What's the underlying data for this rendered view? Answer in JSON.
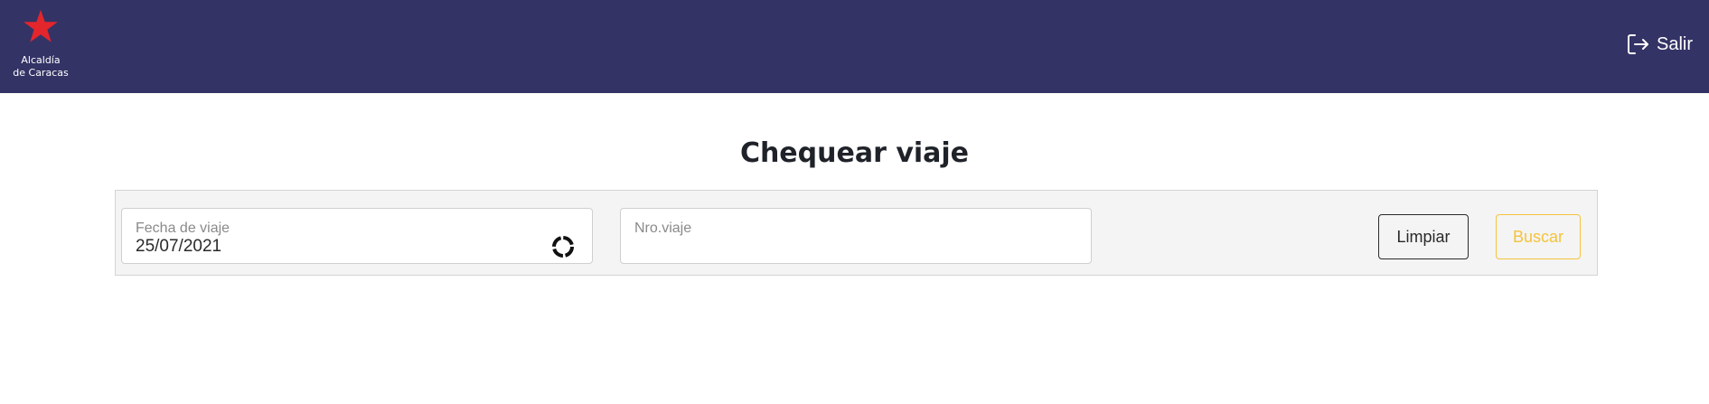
{
  "header": {
    "logo": {
      "line1": "Alcaldía",
      "line2": "de Caracas",
      "star_color": "#e3262c"
    },
    "logout_label": "Salir",
    "background": "#343366"
  },
  "main": {
    "title": "Chequear viaje",
    "filters": {
      "date_label": "Fecha de viaje",
      "date_value": "25/07/2021",
      "trip_label": "Nro.viaje",
      "trip_value": ""
    },
    "buttons": {
      "clear_label": "Limpiar",
      "search_label": "Buscar"
    },
    "accent_color": "#f5c33b"
  }
}
